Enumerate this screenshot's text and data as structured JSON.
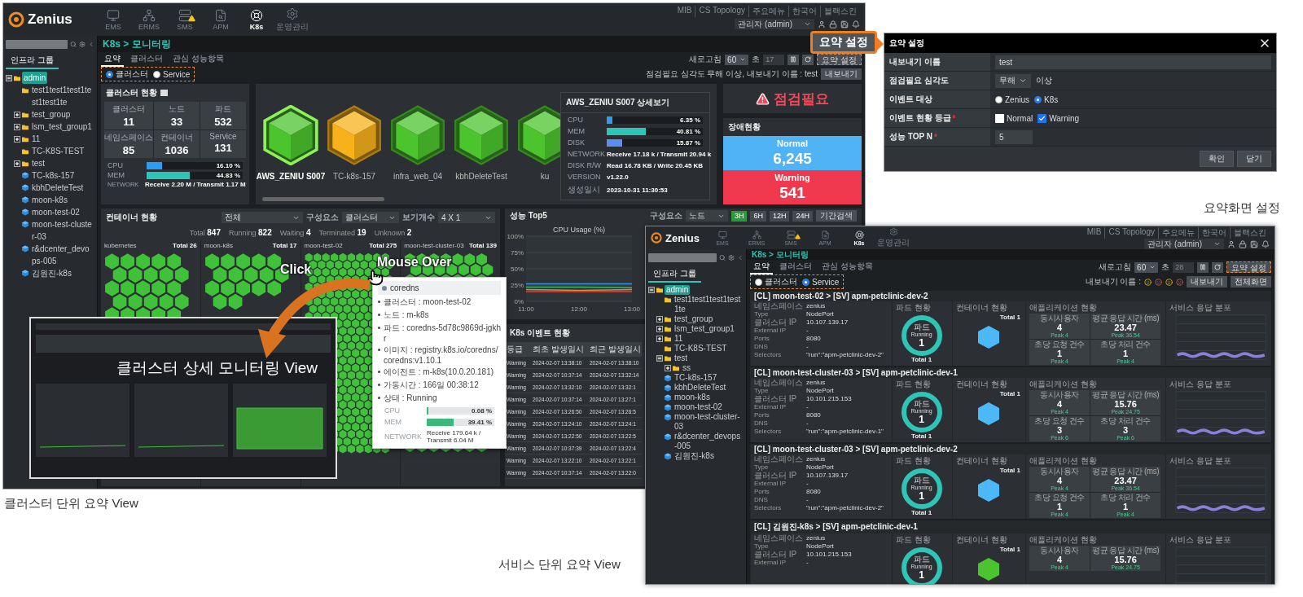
{
  "left_view": {
    "header": {
      "logo": "Zenius",
      "nav": [
        {
          "label": "EMS",
          "selected": false,
          "alert": false
        },
        {
          "label": "ERMS",
          "selected": false,
          "alert": false
        },
        {
          "label": "SMS",
          "selected": false,
          "alert": true
        },
        {
          "label": "APM",
          "selected": false,
          "alert": false
        },
        {
          "label": "K8s",
          "selected": true,
          "alert": false
        },
        {
          "label": "운영관리",
          "selected": false,
          "alert": false
        }
      ],
      "links": [
        "MIB",
        "CS Topology",
        "주요메뉴",
        "한국어",
        "블랙스킨"
      ],
      "user": "관리자 (admin)"
    },
    "breadcrumb": "K8s > 모니터링",
    "sidebar": {
      "tab": {
        "label": "인프라 그룹",
        "selected": true
      },
      "tree": [
        {
          "label": "admin",
          "kind": "group",
          "expanded": true,
          "selected": true,
          "children": [
            {
              "label": "test1test1test1test1test1te",
              "kind": "folder",
              "selected": false
            },
            {
              "label": "test_group",
              "kind": "group",
              "expanded": false,
              "selected": false
            },
            {
              "label": "lsm_test_group1",
              "kind": "group",
              "expanded": false,
              "selected": false
            },
            {
              "label": "11",
              "kind": "group",
              "expanded": false,
              "selected": false
            },
            {
              "label": "TC-K8S-TEST",
              "kind": "folder",
              "selected": false
            },
            {
              "label": "test",
              "kind": "group",
              "expanded": false,
              "selected": false
            },
            {
              "label": "TC-k8s-157",
              "kind": "cluster",
              "selected": false
            },
            {
              "label": "kbhDeleteTest",
              "kind": "cluster",
              "selected": false
            },
            {
              "label": "moon-k8s",
              "kind": "cluster",
              "selected": false
            },
            {
              "label": "moon-test-02",
              "kind": "cluster",
              "selected": false
            },
            {
              "label": "moon-test-cluster-03",
              "kind": "cluster",
              "selected": false
            },
            {
              "label": "r&dcenter_devops-005",
              "kind": "cluster",
              "selected": false
            },
            {
              "label": "김원진-k8s",
              "kind": "cluster",
              "selected": false
            }
          ]
        }
      ]
    },
    "tabs": [
      {
        "label": "요약",
        "selected": true
      },
      {
        "label": "클러스터",
        "selected": false
      },
      {
        "label": "관심 성능항목",
        "selected": false
      }
    ],
    "view_mode": [
      {
        "label": "클러스터",
        "selected": true
      },
      {
        "label": "Service",
        "selected": false
      }
    ],
    "refresh": {
      "label": "새로고침",
      "value": "60",
      "unit": "초",
      "countdown": "17",
      "summary_button": "요약 설정"
    },
    "export_info": "점검필요 심각도 무해 이상, 내보내기 이름 : test",
    "export_button": "내보내기",
    "cluster_status": {
      "title": "클러스터 현황",
      "stats": [
        {
          "label": "클러스터",
          "value": "11"
        },
        {
          "label": "노드",
          "value": "33"
        },
        {
          "label": "파드",
          "value": "532"
        },
        {
          "label": "네임스페이스",
          "value": "85"
        },
        {
          "label": "컨테이너",
          "value": "1036"
        },
        {
          "label": "Service",
          "value": "131"
        }
      ],
      "metrics": [
        {
          "label": "CPU",
          "level": 0.161,
          "reading": "16.10 %",
          "color": "#2a9df4"
        },
        {
          "label": "MEM",
          "level": 0.4483,
          "reading": "44.83 %",
          "color": "#2ec4b6"
        }
      ],
      "network": {
        "label": "NETWORK",
        "value": "Receive 2.20 M / Transmit 1.17 M"
      }
    },
    "clusters": [
      {
        "name": "AWS_ZENIU S007",
        "color": "#4cc42e",
        "selected": true
      },
      {
        "name": "TC-k8s-157",
        "color": "#f7b21b",
        "selected": false
      },
      {
        "name": "infra_web_04",
        "color": "#4cc42e",
        "selected": false
      },
      {
        "name": "kbhDeleteTest",
        "color": "#4cc42e",
        "selected": false
      },
      {
        "name": "ku",
        "color": "#4cc42e",
        "selected": false
      }
    ],
    "cluster_detail": {
      "title": "AWS_ZENIU S007 상세보기",
      "metrics": [
        {
          "label": "CPU",
          "level": 0.0635,
          "reading": "6.35 %",
          "color": "#2a9df4"
        },
        {
          "label": "MEM",
          "level": 0.4081,
          "reading": "40.81 %",
          "color": "#2ec4b6"
        },
        {
          "label": "DISK",
          "level": 0.1587,
          "reading": "15.87 %",
          "color": "#5b8ef5"
        }
      ],
      "info": [
        {
          "label": "NETWORK",
          "value": "Receive 17.18 k / Transmit 20.94 k"
        },
        {
          "label": "DISK R/W",
          "value": "Read 16.78 KB / Write 20.45 KB"
        },
        {
          "label": "VERSION",
          "value": "v1.22.0"
        },
        {
          "label": "생성일시",
          "value": "2023-10-31 11:30:53"
        }
      ]
    },
    "alert": "점검필요",
    "faults": {
      "title": "장애현황",
      "items": [
        {
          "label": "Normal",
          "value": "6,245",
          "color": "#4fb3f6"
        },
        {
          "label": "Warning",
          "value": "541",
          "color": "#f0384f"
        }
      ]
    },
    "containers": {
      "title": "컨테이너 현황",
      "filters": [
        {
          "value": "전체"
        },
        {
          "label": "구성요소",
          "value": "클러스터"
        },
        {
          "label": "보기개수",
          "value": "4 X 1"
        }
      ],
      "totals": [
        {
          "label": "Total",
          "value": "847"
        },
        {
          "label": "Running",
          "value": "822"
        },
        {
          "label": "Waiting",
          "value": "4"
        },
        {
          "label": "Terminated",
          "value": "19"
        },
        {
          "label": "Unknown",
          "value": "2"
        }
      ],
      "groups": [
        {
          "name": "kubernetes",
          "total": "Total 26"
        },
        {
          "name": "moon-k8s",
          "total": "Total 17"
        },
        {
          "name": "moon-test-02",
          "total": "Total 275"
        },
        {
          "name": "moon-test-cluster-03",
          "total": "Total 139"
        }
      ]
    },
    "performance": {
      "title": "성능 Top5",
      "filter_label": "구성요소",
      "filter_value": "노드",
      "ranges": [
        {
          "label": "3H",
          "selected": true
        },
        {
          "label": "6H",
          "selected": false
        },
        {
          "label": "12H",
          "selected": false
        },
        {
          "label": "24H",
          "selected": false
        }
      ],
      "search_button": "기간검색",
      "chart_data": {
        "type": "line",
        "title": "CPU Usage (%)",
        "x": [
          "11:00",
          "12:00",
          "13:00"
        ],
        "series": [
          {
            "color": "#3b8fd9",
            "values": [
              27,
              27,
              27
            ]
          },
          {
            "color": "#2fbf71",
            "values": [
              22,
              22,
              21
            ]
          },
          {
            "color": "#e8833a",
            "values": [
              18,
              17,
              18
            ]
          },
          {
            "color": "#e04545",
            "values": [
              15,
              15,
              15
            ]
          }
        ],
        "ylim": [
          0,
          100
        ],
        "yticks": [
          {
            "value": 0,
            "label": "0%"
          },
          {
            "value": 25,
            "label": "25%"
          },
          {
            "value": 50,
            "label": "50%"
          },
          {
            "value": 75,
            "label": "75%"
          },
          {
            "value": 100,
            "label": "100%"
          }
        ],
        "grid": true
      }
    },
    "events": {
      "title": "K8s 이벤트 현황",
      "columns": [
        "등급",
        "최초 발생일시",
        "최근 발생일시"
      ],
      "rows": [
        [
          "Warning",
          "2024-02-07 13:38:10",
          "2024-02-07 13:38:10"
        ],
        [
          "Warning",
          "2024-02-07 10:37:14",
          "2024-02-07 13:32:14"
        ],
        [
          "Warning",
          "2024-02-07 13:32:10",
          "2024-02-07 13:32:1"
        ],
        [
          "Warning",
          "2024-02-07 10:37:14",
          "2024-02-07 13:27:1"
        ],
        [
          "Warning",
          "2024-02-07 13:26:50",
          "2024-02-07 13:26:5"
        ],
        [
          "Warning",
          "2024-02-07 13:24:10",
          "2024-02-07 13:24:1"
        ],
        [
          "Warning",
          "2024-02-07 13:22:50",
          "2024-02-07 13:22:5"
        ],
        [
          "Warning",
          "2024-02-07 10:37:39",
          "2024-02-07 13:22:4"
        ],
        [
          "Warning",
          "2024-02-07 13:22:10",
          "2024-02-07 13:22:1"
        ],
        [
          "Warning",
          "2024-02-07 10:37:14",
          "2024-02-07 13:22:0"
        ]
      ]
    },
    "annotations": {
      "click": "Click",
      "mouse_over": "Mouse Over"
    },
    "tooltip": {
      "title": "coredns",
      "lines": [
        "클러스터 : moon-test-02",
        "노드 : m-k8s",
        "파드 : coredns-5d78c9869d-jgkhr",
        "이미지 : registry.k8s.io/coredns/coredns:v1.10.1",
        "에이전트 : m-k8s(10.0.20.181)",
        "가동시간 : 166일 00:38:12",
        "상태 : Running"
      ],
      "metrics": [
        {
          "label": "CPU",
          "level": 0.0008,
          "reading": "0.08 %",
          "color": "#3cb878"
        },
        {
          "label": "MEM",
          "level": 0.3941,
          "reading": "39.41 %",
          "color": "#3cb878"
        }
      ],
      "network": {
        "label": "NETWORK",
        "value": "Receive 179.64 k / Transmit 6.04 M"
      }
    },
    "detail_thumbnail": {
      "caption": "클러스터 상세 모니터링 View"
    }
  },
  "left_caption": "클러스터 단위 요약 View",
  "callout_button": "요약 설정",
  "summary_dialog": {
    "title": "요약 설정",
    "rows": [
      {
        "kind": "text",
        "label": "내보내기 이름",
        "value": "test"
      },
      {
        "kind": "select",
        "label": "점검필요 심각도",
        "value": "무해",
        "suffix": "이상"
      },
      {
        "kind": "radio",
        "label": "이벤트 대상",
        "options": [
          {
            "label": "Zenius",
            "selected": false
          },
          {
            "label": "K8s",
            "selected": true
          }
        ]
      },
      {
        "kind": "checkbox",
        "label": "이벤트 현황 등급",
        "required_mark": "*",
        "options": [
          {
            "label": "Normal",
            "checked": false
          },
          {
            "label": "Warning",
            "checked": true
          }
        ]
      },
      {
        "kind": "short_text",
        "label": "성능 TOP N",
        "required_mark": "*",
        "value": "5"
      }
    ],
    "buttons": [
      "확인",
      "닫기"
    ]
  },
  "dialog_caption": "요약화면 설정",
  "right_view": {
    "header": {
      "logo": "Zenius",
      "nav": [
        {
          "label": "EMS",
          "selected": false,
          "alert": false
        },
        {
          "label": "ERMS",
          "selected": false,
          "alert": false
        },
        {
          "label": "SMS",
          "selected": false,
          "alert": true
        },
        {
          "label": "APM",
          "selected": false,
          "alert": false
        },
        {
          "label": "K8s",
          "selected": true,
          "alert": false
        },
        {
          "label": "운영관리",
          "selected": false,
          "alert": false
        }
      ],
      "links": [
        "MIB",
        "CS Topology",
        "주요메뉴",
        "한국어",
        "블랙스킨"
      ],
      "user": "관리자 (admin)"
    },
    "breadcrumb": "K8s > 모니터링",
    "sidebar": {
      "tab": {
        "label": "인프라 그룹",
        "selected": true
      },
      "tree": [
        {
          "label": "admin",
          "kind": "group",
          "expanded": true,
          "selected": true,
          "children": [
            {
              "label": "test1test1test1test1te",
              "kind": "folder",
              "selected": false
            },
            {
              "label": "test_group",
              "kind": "group",
              "expanded": false,
              "selected": false
            },
            {
              "label": "lsm_test_group1",
              "kind": "group",
              "expanded": false,
              "selected": false
            },
            {
              "label": "11",
              "kind": "group",
              "expanded": false,
              "selected": false
            },
            {
              "label": "TC-K8S-TEST",
              "kind": "folder",
              "selected": false
            },
            {
              "label": "test",
              "kind": "group",
              "expanded": true,
              "selected": false,
              "children": [
                {
                  "label": "ss",
                  "kind": "group",
                  "expanded": false,
                  "selected": false
                }
              ]
            },
            {
              "label": "TC-k8s-157",
              "kind": "cluster",
              "selected": false
            },
            {
              "label": "kbhDeleteTest",
              "kind": "cluster",
              "selected": false
            },
            {
              "label": "moon-k8s",
              "kind": "cluster",
              "selected": false
            },
            {
              "label": "moon-test-02",
              "kind": "cluster",
              "selected": false
            },
            {
              "label": "moon-test-cluster-03",
              "kind": "cluster",
              "selected": false
            },
            {
              "label": "r&dcenter_devops-005",
              "kind": "cluster",
              "selected": false
            },
            {
              "label": "김원진-k8s",
              "kind": "cluster",
              "selected": false
            }
          ]
        }
      ]
    },
    "tabs": [
      {
        "label": "요약",
        "selected": true
      },
      {
        "label": "클러스터",
        "selected": false
      },
      {
        "label": "관심 성능항목",
        "selected": false
      }
    ],
    "view_mode": [
      {
        "label": "클러스터",
        "selected": false
      },
      {
        "label": "Service",
        "selected": true
      }
    ],
    "refresh": {
      "label": "새로고침",
      "value": "60",
      "unit": "초",
      "countdown": "28",
      "summary_button": "요약 설정"
    },
    "export_label": "내보내기 이름 :",
    "buttons": [
      "내보내기",
      "전체화면"
    ],
    "cards": [
      {
        "title": "[CL] moon-test-02 > [SV] apm-petclinic-dev-2",
        "info": [
          {
            "label": "네임스페이스",
            "value": "zenius"
          },
          {
            "label": "Type",
            "value": "NodePort"
          },
          {
            "label": "클러스터 IP",
            "value": "10.107.139.17"
          },
          {
            "label": "External IP",
            "value": "-"
          },
          {
            "label": "Ports",
            "value": "8080"
          },
          {
            "label": "DNS",
            "value": "-"
          },
          {
            "label": "Selectors",
            "value": "\"run\":\"apm-petclinic-dev-2\""
          }
        ],
        "pod": {
          "title": "파드 현황",
          "label": "파드",
          "status": "Running",
          "count": "1",
          "total": "Total 1"
        },
        "container": {
          "title": "컨테이너 현황",
          "total": "Total 1",
          "color": "#4db8f7"
        },
        "app": {
          "title": "애플리케이션 현황",
          "stats": [
            {
              "label": "동시사용자",
              "value": "4",
              "peak": "Peak 4"
            },
            {
              "label": "평균 응답 시간 (ms)",
              "value": "23.47",
              "peak": "Peak 36.54"
            },
            {
              "label": "초당 요청 건수",
              "value": "1",
              "peak": "Peak 4"
            },
            {
              "label": "초당 처리 건수",
              "value": "1",
              "peak": "Peak 4"
            }
          ]
        },
        "response_title": "서비스 응답 분포"
      },
      {
        "title": "[CL] moon-test-cluster-03 > [SV] apm-petclinic-dev-1",
        "info": [
          {
            "label": "네임스페이스",
            "value": "zenius"
          },
          {
            "label": "Type",
            "value": "NodePort"
          },
          {
            "label": "클러스터 IP",
            "value": "10.101.215.153"
          },
          {
            "label": "External IP",
            "value": "-"
          },
          {
            "label": "Ports",
            "value": "8080"
          },
          {
            "label": "DNS",
            "value": "-"
          },
          {
            "label": "Selectors",
            "value": "\"run\":\"apm-petclinic-dev-1\""
          }
        ],
        "pod": {
          "title": "파드 현황",
          "label": "파드",
          "status": "Running",
          "count": "1",
          "total": "Total 1"
        },
        "container": {
          "title": "컨테이너 현황",
          "total": "Total 1",
          "color": "#4db8f7"
        },
        "app": {
          "title": "애플리케이션 현황",
          "stats": [
            {
              "label": "동시사용자",
              "value": "4",
              "peak": "Peak 4"
            },
            {
              "label": "평균 응답 시간 (ms)",
              "value": "15.76",
              "peak": "Peak 24.75"
            },
            {
              "label": "초당 요청 건수",
              "value": "3",
              "peak": "Peak 6"
            },
            {
              "label": "초당 처리 건수",
              "value": "3",
              "peak": "Peak 6"
            }
          ]
        },
        "response_title": "서비스 응답 분포"
      },
      {
        "title": "[CL] moon-test-cluster-03 > [SV] apm-petclinic-dev-2",
        "info": [
          {
            "label": "네임스페이스",
            "value": "zenius"
          },
          {
            "label": "Type",
            "value": "NodePort"
          },
          {
            "label": "클러스터 IP",
            "value": "10.107.139.17"
          },
          {
            "label": "External IP",
            "value": "-"
          },
          {
            "label": "Ports",
            "value": "8080"
          },
          {
            "label": "DNS",
            "value": "-"
          },
          {
            "label": "Selectors",
            "value": "\"run\":\"apm-petclinic-dev-2\""
          }
        ],
        "pod": {
          "title": "파드 현황",
          "label": "파드",
          "status": "Running",
          "count": "1",
          "total": "Total 1"
        },
        "container": {
          "title": "컨테이너 현황",
          "total": "Total 1",
          "color": "#4db8f7"
        },
        "app": {
          "title": "애플리케이션 현황",
          "stats": [
            {
              "label": "동시사용자",
              "value": "4",
              "peak": "Peak 4"
            },
            {
              "label": "평균 응답 시간 (ms)",
              "value": "23.47",
              "peak": "Peak 36.54"
            },
            {
              "label": "초당 요청 건수",
              "value": "1",
              "peak": "Peak 4"
            },
            {
              "label": "초당 처리 건수",
              "value": "1",
              "peak": "Peak 4"
            }
          ]
        },
        "response_title": "서비스 응답 분포"
      },
      {
        "title": "[CL] 김원진-k8s > [SV] apm-petclinic-dev-1",
        "info": [
          {
            "label": "네임스페이스",
            "value": "zenius"
          },
          {
            "label": "Type",
            "value": "NodePort"
          },
          {
            "label": "클러스터 IP",
            "value": "10.101.215.153"
          },
          {
            "label": "External IP",
            "value": "-"
          }
        ],
        "pod": {
          "title": "파드 현황",
          "label": "파드",
          "status": "Running",
          "count": "1"
        },
        "container": {
          "title": "컨테이너 현황",
          "total": "Total 1",
          "color": "#4cc42e"
        },
        "app": {
          "title": "애플리케이션 현황",
          "stats": [
            {
              "label": "동시사용자",
              "value": "4",
              "peak": "Peak 4"
            },
            {
              "label": "평균 응답 시간 (ms)",
              "value": "15.76",
              "peak": "Peak 24.75"
            }
          ]
        },
        "response_title": "서비스 응답 분포"
      }
    ]
  },
  "right_caption": "서비스 단위 요약 View"
}
